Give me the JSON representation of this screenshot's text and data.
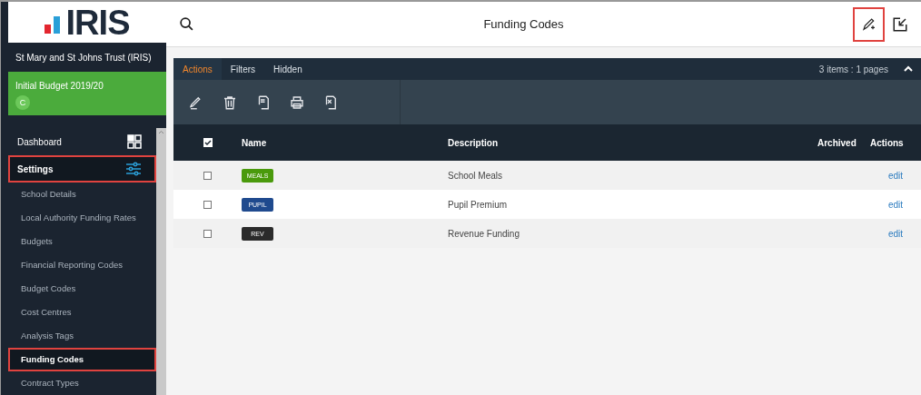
{
  "logo": {
    "text": "IRIS"
  },
  "sidebar": {
    "organisation": "St Mary and St Johns Trust (IRIS)",
    "budget": {
      "title": "Initial Budget 2019/20",
      "badge": "C"
    },
    "items": [
      {
        "label": "Dashboard",
        "kind": "section",
        "selected": false,
        "highlighted": false
      },
      {
        "label": "Settings",
        "kind": "section",
        "selected": true,
        "highlighted": true
      },
      {
        "label": "School Details",
        "kind": "sub",
        "selected": false,
        "highlighted": false
      },
      {
        "label": "Local Authority Funding Rates",
        "kind": "sub",
        "selected": false,
        "highlighted": false
      },
      {
        "label": "Budgets",
        "kind": "sub",
        "selected": false,
        "highlighted": false
      },
      {
        "label": "Financial Reporting Codes",
        "kind": "sub",
        "selected": false,
        "highlighted": false
      },
      {
        "label": "Budget Codes",
        "kind": "sub",
        "selected": false,
        "highlighted": false
      },
      {
        "label": "Cost Centres",
        "kind": "sub",
        "selected": false,
        "highlighted": false
      },
      {
        "label": "Analysis Tags",
        "kind": "sub",
        "selected": false,
        "highlighted": false
      },
      {
        "label": "Funding Codes",
        "kind": "sub",
        "selected": true,
        "highlighted": true
      },
      {
        "label": "Contract Types",
        "kind": "sub",
        "selected": false,
        "highlighted": false
      }
    ]
  },
  "header": {
    "title": "Funding Codes",
    "add_highlighted": true
  },
  "panel": {
    "tabs": [
      {
        "label": "Actions",
        "selected": true
      },
      {
        "label": "Filters",
        "selected": false
      },
      {
        "label": "Hidden",
        "selected": false
      }
    ],
    "count": "3 items : 1 pages",
    "columns": [
      "Name",
      "Description",
      "Archived",
      "Actions"
    ],
    "select_all": {
      "checked": true
    },
    "rows": [
      {
        "code": "MEALS",
        "color": "#4a9a0c",
        "description": "School Meals",
        "action": "edit",
        "checked": false
      },
      {
        "code": "PUPIL",
        "color": "#1f4a8e",
        "description": "Pupil Premium",
        "action": "edit",
        "checked": false
      },
      {
        "code": "REV",
        "color": "#2b2b2b",
        "description": "Revenue Funding",
        "action": "edit",
        "checked": false
      }
    ]
  }
}
